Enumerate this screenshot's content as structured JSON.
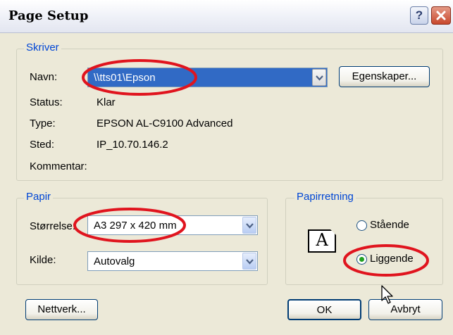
{
  "window": {
    "title": "Page Setup"
  },
  "printer": {
    "legend": "Skriver",
    "name_label": "Navn:",
    "name_value": "\\\\tts01\\Epson",
    "properties_button": "Egenskaper...",
    "status_label": "Status:",
    "status_value": "Klar",
    "type_label": "Type:",
    "type_value": "EPSON AL-C9100 Advanced",
    "location_label": "Sted:",
    "location_value": "IP_10.70.146.2",
    "comment_label": "Kommentar:"
  },
  "paper": {
    "legend": "Papir",
    "size_label": "Størrelse:",
    "size_value": "A3 297 x 420 mm",
    "source_label": "Kilde:",
    "source_value": "Autovalg"
  },
  "orientation": {
    "legend": "Papirretning",
    "preview_glyph": "A",
    "portrait_label": "Stående",
    "landscape_label": "Liggende",
    "selected": "Liggende"
  },
  "buttons": {
    "network": "Nettverk...",
    "ok": "OK",
    "cancel": "Avbryt"
  },
  "colors": {
    "highlight_circle": "#e0141e",
    "group_title": "#0046d5",
    "selection": "#316ac5"
  }
}
